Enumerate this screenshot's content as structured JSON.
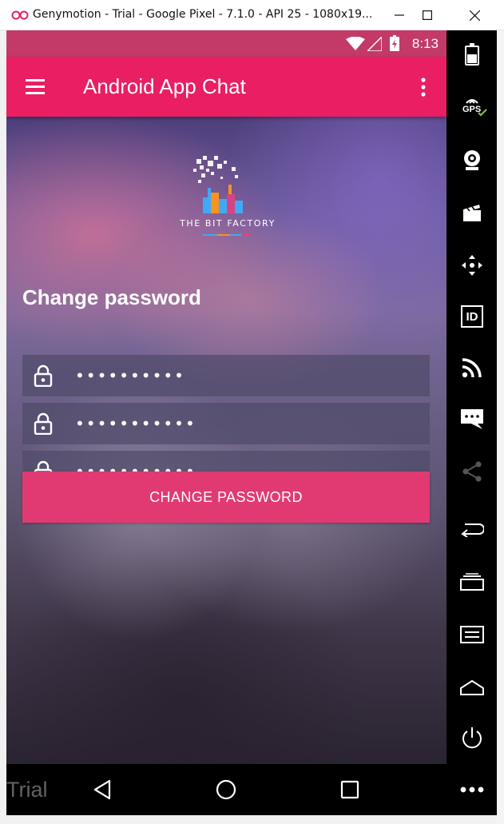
{
  "window": {
    "title": "Genymotion - Trial - Google Pixel - 7.1.0 - API 25 - 1080x19..."
  },
  "status_bar": {
    "time": "8:13"
  },
  "app_bar": {
    "title": "Android App Chat"
  },
  "logo": {
    "text": "THE BIT FACTORY"
  },
  "form": {
    "heading": "Change password",
    "fields": [
      {
        "value": "••••••••••"
      },
      {
        "value": "•••••••••••"
      },
      {
        "value": "•••••••••••"
      }
    ],
    "submit_label": "CHANGE PASSWORD"
  },
  "overlay": {
    "watermark": "Trial"
  },
  "sidebar": {
    "gps_label": "GPS",
    "id_label": "ID"
  },
  "colors": {
    "status_bar": "#c33a69",
    "app_bar": "#e91e63",
    "button": "#e13a72"
  }
}
